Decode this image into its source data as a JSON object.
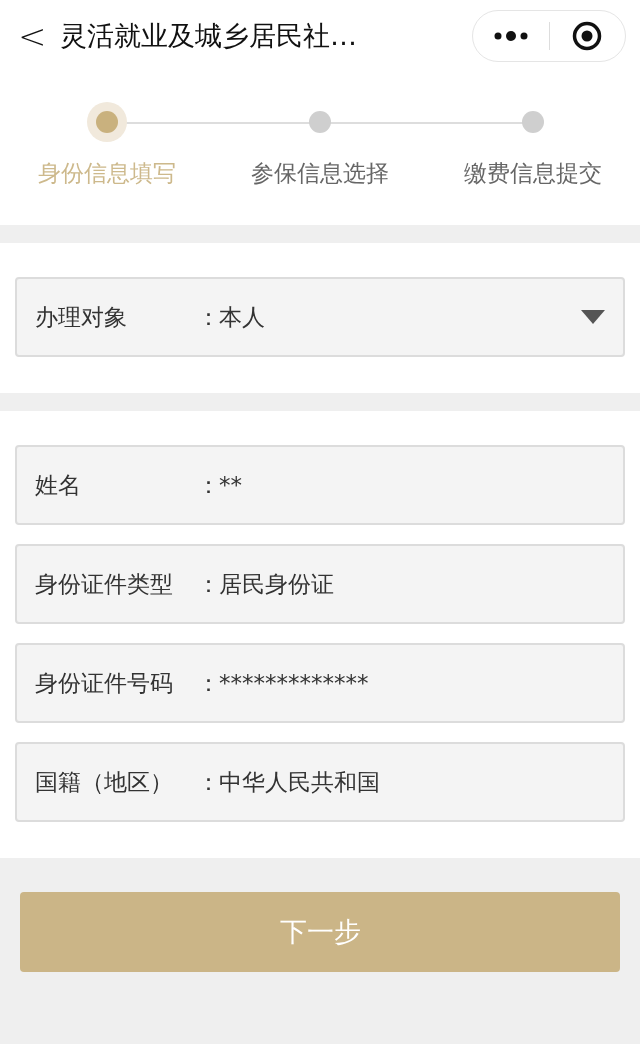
{
  "nav": {
    "back": "<",
    "title": "灵活就业及城乡居民社…"
  },
  "steps": [
    {
      "label": "身份信息填写",
      "selected": true
    },
    {
      "label": "参保信息选择",
      "selected": false
    },
    {
      "label": "缴费信息提交",
      "selected": false
    }
  ],
  "subject": {
    "label": "办理对象",
    "separator": "：",
    "value": "本人"
  },
  "fields": [
    {
      "label": "姓名",
      "separator": "：",
      "value": "**"
    },
    {
      "label": "身份证件类型",
      "separator": "：",
      "value": "居民身份证"
    },
    {
      "label": "身份证件号码",
      "separator": "：",
      "value": "*************"
    },
    {
      "label": "国籍（地区）",
      "separator": "：",
      "value": "中华人民共和国"
    }
  ],
  "next_button": "下一步"
}
